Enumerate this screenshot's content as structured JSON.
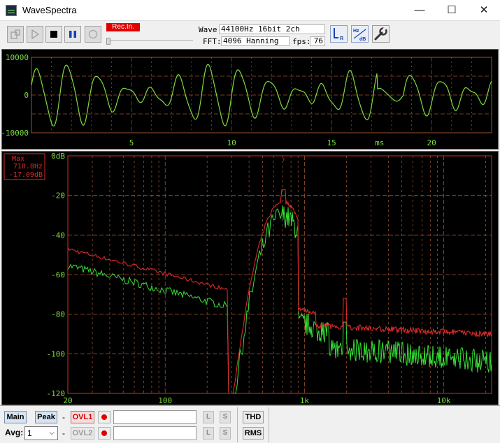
{
  "window": {
    "title": "WaveSpectra",
    "min_glyph": "—",
    "max_glyph": "☐",
    "close_glyph": "✕"
  },
  "toolbar": {
    "rec_status": "Rec.In.",
    "wave_label": "Wave:",
    "wave_value": "44100Hz 16bit 2ch",
    "fft_label": "FFT:",
    "fft_value": "4096 Hanning",
    "fps_label": "fps:",
    "fps_value": "76",
    "icons": [
      "device-icon",
      "play-icon",
      "stop-icon",
      "pause-icon",
      "record-icon",
      "lr-channel-icon",
      "hz-db-icon",
      "settings-wrench-icon"
    ]
  },
  "waveform": {
    "y_ticks": [
      "10000",
      "0",
      "-10000"
    ],
    "x_ticks": [
      "5",
      "10",
      "15",
      "20"
    ],
    "x_unit": "ms",
    "trace_color": "#7fdc3c",
    "grid_color": "#a0522d"
  },
  "spectrum": {
    "max_label": "Max",
    "max_freq": "710.8Hz",
    "max_db": "-17.09dB",
    "y_ticks": [
      "0dB",
      "-20",
      "-40",
      "-60",
      "-80",
      "-100",
      "-120"
    ],
    "x_ticks": [
      "20",
      "100",
      "1k",
      "10k"
    ],
    "peak_color": "#dc2a2a",
    "live_color": "#35e235"
  },
  "bottom": {
    "main_label": "Main",
    "peak_label": "Peak",
    "ovl1_label": "OVL1",
    "ovl2_label": "OVL2",
    "dash": "-",
    "l_label": "L",
    "s_label": "S",
    "thd_label": "THD",
    "rms_label": "RMS",
    "avg_label": "Avg:",
    "avg_value": "1"
  }
}
